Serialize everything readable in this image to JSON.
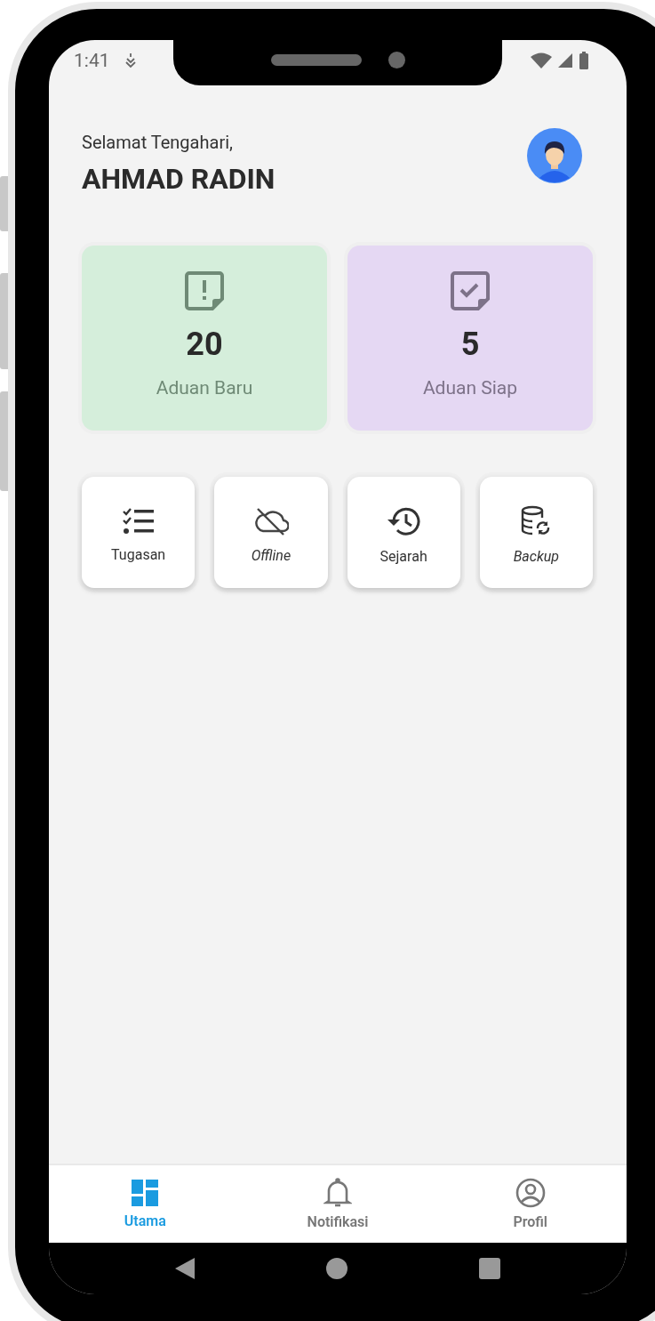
{
  "status_bar": {
    "time": "1:41"
  },
  "header": {
    "greeting": "Selamat Tengahari,",
    "name": "AHMAD RADIN"
  },
  "stats": [
    {
      "value": "20",
      "label": "Aduan Baru",
      "color": "#d5eedb"
    },
    {
      "value": "5",
      "label": "Aduan Siap",
      "color": "#e5d8f3"
    }
  ],
  "shortcuts": [
    {
      "label": "Tugasan",
      "italic": false
    },
    {
      "label": "Offline",
      "italic": true
    },
    {
      "label": "Sejarah",
      "italic": false
    },
    {
      "label": "Backup",
      "italic": true
    }
  ],
  "bottom_nav": [
    {
      "label": "Utama",
      "selected": true
    },
    {
      "label": "Notifikasi",
      "selected": false
    },
    {
      "label": "Profil",
      "selected": false
    }
  ]
}
